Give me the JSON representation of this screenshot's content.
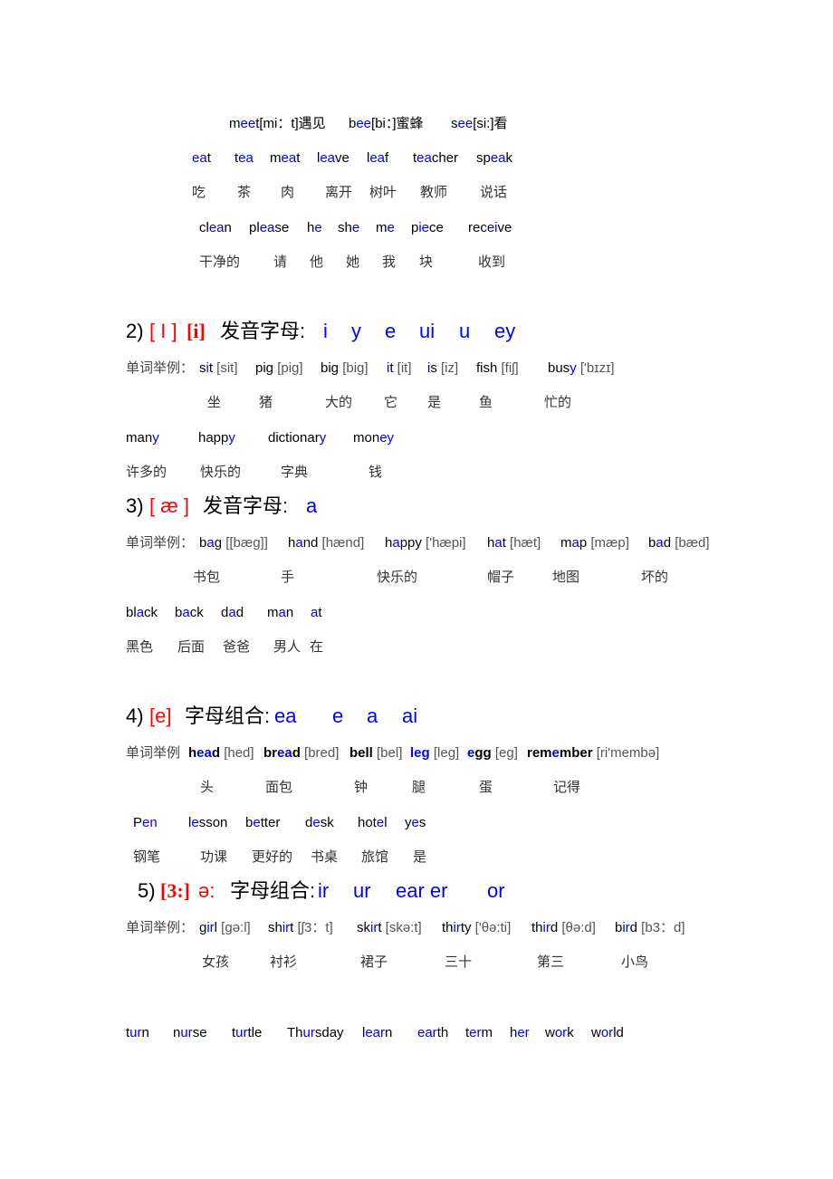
{
  "colors": {
    "highlight": "#0000ff",
    "phonetic_symbol": "#ff0000",
    "text": "#000000",
    "ipa": "#555555"
  },
  "section1": {
    "examples": [
      {
        "pre": "m",
        "hl": "ee",
        "post": "t[mi：t]遇见"
      },
      {
        "pre": "b",
        "hl": "ee",
        "post": "[bi：]蜜蜂"
      },
      {
        "pre": "s",
        "hl": "ee",
        "post": "[si:]看"
      }
    ],
    "words1": [
      {
        "pre": "",
        "hl": "ea",
        "post": "t"
      },
      {
        "pre": "t",
        "hl": "ea",
        "post": ""
      },
      {
        "pre": "m",
        "hl": "ea",
        "post": "t"
      },
      {
        "pre": "l",
        "hl": "ea",
        "post": "ve"
      },
      {
        "pre": "l",
        "hl": "ea",
        "post": "f"
      },
      {
        "pre": "t",
        "hl": "ea",
        "post": "cher"
      },
      {
        "pre": "sp",
        "hl": "ea",
        "post": "k"
      }
    ],
    "meanings1": [
      "吃",
      "茶",
      "肉",
      "离开",
      "树叶",
      "教师",
      "说话"
    ],
    "words2": [
      {
        "pre": "cl",
        "hl": "ea",
        "post": "n"
      },
      {
        "pre": "pl",
        "hl": "ea",
        "post": "se"
      },
      {
        "pre": "h",
        "hl": "e",
        "post": ""
      },
      {
        "pre": "sh",
        "hl": "e",
        "post": ""
      },
      {
        "pre": "m",
        "hl": "e",
        "post": ""
      },
      {
        "pre": "p",
        "hl": "ie",
        "post": "ce"
      },
      {
        "pre": "rec",
        "hl": "ei",
        "post": "ve"
      }
    ],
    "meanings2": [
      "干净的",
      "请",
      "他",
      "她",
      "我",
      "块",
      "收到"
    ]
  },
  "section2": {
    "heading": [
      {
        "t": "2)",
        "c": "black"
      },
      {
        "t": "[ Ι ]",
        "c": "red"
      },
      {
        "t": "[i]",
        "c": "red serif"
      },
      {
        "t": "发音字母:",
        "c": "black"
      },
      {
        "t": "i",
        "c": "blue"
      },
      {
        "t": "y",
        "c": "blue"
      },
      {
        "t": "e",
        "c": "blue"
      },
      {
        "t": "ui",
        "c": "blue"
      },
      {
        "t": "u",
        "c": "blue"
      },
      {
        "t": "ey",
        "c": "blue"
      }
    ],
    "label": "单词举例：",
    "examples": [
      {
        "pre": "s",
        "hl": "i",
        "post": "t",
        "ipa": " [sit]"
      },
      {
        "pre": "pig",
        "hl": "",
        "post": "",
        "ipa": " [piɡ]"
      },
      {
        "pre": "big",
        "hl": "",
        "post": "",
        "ipa": " [biɡ]"
      },
      {
        "pre": "",
        "hl": "i",
        "post": "t",
        "ipa": " [it]"
      },
      {
        "pre": "",
        "hl": "i",
        "post": "s",
        "ipa": " [iz]"
      },
      {
        "pre": "fish",
        "hl": "",
        "post": "",
        "ipa": " [fiʃ]"
      },
      {
        "pre": "bus",
        "hl": "y",
        "post": "",
        "ipa": " ['bɪzɪ]"
      }
    ],
    "meanings": [
      "坐",
      "猪",
      "大的",
      "它",
      "是",
      "鱼",
      "忙的"
    ],
    "words": [
      {
        "pre": "man",
        "hl": "y",
        "post": ""
      },
      {
        "pre": "happ",
        "hl": "y",
        "post": ""
      },
      {
        "pre": "dictionar",
        "hl": "y",
        "post": ""
      },
      {
        "pre": "mon",
        "hl": "ey",
        "post": ""
      }
    ],
    "meanings2": [
      "许多的",
      "快乐的",
      "字典",
      "钱"
    ]
  },
  "section3": {
    "heading": [
      {
        "t": "3)",
        "c": "black"
      },
      {
        "t": "[ æ ]",
        "c": "red"
      },
      {
        "t": "发音字母:",
        "c": "black"
      },
      {
        "t": "a",
        "c": "blue"
      }
    ],
    "label": "单词举例：",
    "examples": [
      {
        "pre": "b",
        "hl": "a",
        "post": "g",
        "ipa": " [[bæɡ]]"
      },
      {
        "pre": "h",
        "hl": "a",
        "post": "nd",
        "ipa": " [hænd]"
      },
      {
        "pre": "h",
        "hl": "a",
        "post": "ppy",
        "ipa": " ['hæpi]"
      },
      {
        "pre": "h",
        "hl": "a",
        "post": "t",
        "ipa": " [hæt]"
      },
      {
        "pre": "m",
        "hl": "a",
        "post": "p",
        "ipa": " [mæp]"
      },
      {
        "pre": "b",
        "hl": "a",
        "post": "d",
        "ipa": " [bæd]"
      }
    ],
    "meanings": [
      "书包",
      "手",
      "快乐的",
      "帽子",
      "地图",
      "坏的"
    ],
    "words": [
      {
        "pre": "bl",
        "hl": "a",
        "post": "ck"
      },
      {
        "pre": "b",
        "hl": "a",
        "post": "ck"
      },
      {
        "pre": "d",
        "hl": "a",
        "post": "d"
      },
      {
        "pre": "m",
        "hl": "a",
        "post": "n"
      },
      {
        "pre": "",
        "hl": "a",
        "post": "t"
      }
    ],
    "meanings2": [
      "黑色",
      "后面",
      "爸爸",
      "男人",
      "在"
    ]
  },
  "section4": {
    "heading": [
      {
        "t": "4)",
        "c": "black"
      },
      {
        "t": "[e]",
        "c": "red"
      },
      {
        "t": "字母组合:",
        "c": "black"
      },
      {
        "t": "ea",
        "c": "blue"
      },
      {
        "t": "e",
        "c": "blue"
      },
      {
        "t": "a",
        "c": "blue"
      },
      {
        "t": "ai",
        "c": "blue"
      }
    ],
    "label": "单词举例",
    "examples": [
      {
        "pre": "h",
        "hl": "ea",
        "post": "d",
        "ipa": " [hed]"
      },
      {
        "pre": "br",
        "hl": "ea",
        "post": "d",
        "ipa": " [bred]"
      },
      {
        "pre": "bell",
        "hl": "",
        "post": "",
        "ipa": " [bel]"
      },
      {
        "pre": "",
        "hl": "leg",
        "post": "",
        "ipa": " [leg]"
      },
      {
        "pre": "",
        "hl": "e",
        "post": "gg",
        "ipa": " [eg]"
      },
      {
        "pre": "rem",
        "hl": "e",
        "post": "mber",
        "ipa": " [ri'membə]"
      }
    ],
    "meanings": [
      "头",
      "面包",
      "钟",
      "腿",
      "蛋",
      "记得"
    ],
    "words": [
      {
        "pre": "P",
        "hl": "en",
        "post": ""
      },
      {
        "pre": "l",
        "hl": "e",
        "post": "sson"
      },
      {
        "pre": "b",
        "hl": "e",
        "post": "tter"
      },
      {
        "pre": "d",
        "hl": "e",
        "post": "sk"
      },
      {
        "pre": "hot",
        "hl": "e",
        "post": "l"
      },
      {
        "pre": "y",
        "hl": "e",
        "post": "s"
      }
    ],
    "meanings2": [
      "钢笔",
      "功课",
      "更好的",
      "书桌",
      "旅馆",
      "是"
    ]
  },
  "section5": {
    "heading": [
      {
        "t": "5)",
        "c": "black"
      },
      {
        "t": "[3:]",
        "c": "red serif"
      },
      {
        "t": "ə:",
        "c": "red"
      },
      {
        "t": "字母组合:",
        "c": "black"
      },
      {
        "t": "ir",
        "c": "blue"
      },
      {
        "t": "ur",
        "c": "blue"
      },
      {
        "t": "ear er",
        "c": "blue"
      },
      {
        "t": "or",
        "c": "blue"
      }
    ],
    "label": "单词举例：",
    "examples": [
      {
        "pre": "g",
        "hl": "ir",
        "post": "l",
        "ipa": " [ɡə:l]"
      },
      {
        "pre": "sh",
        "hl": "ir",
        "post": "t",
        "ipa": " [ʃ3：t]"
      },
      {
        "pre": "sk",
        "hl": "ir",
        "post": "t",
        "ipa": " [skə:t]"
      },
      {
        "pre": "th",
        "hl": "ir",
        "post": "ty",
        "ipa": " ['θə:ti]"
      },
      {
        "pre": "th",
        "hl": "ir",
        "post": "d",
        "ipa": " [θə:d]"
      },
      {
        "pre": "b",
        "hl": "ir",
        "post": "d",
        "ipa": " [b3：d]"
      }
    ],
    "meanings": [
      "女孩",
      "衬衫",
      "裙子",
      "三十",
      "第三",
      "小鸟"
    ],
    "words": [
      {
        "pre": "t",
        "hl": "ur",
        "post": "n"
      },
      {
        "pre": "n",
        "hl": "ur",
        "post": "se"
      },
      {
        "pre": "t",
        "hl": "ur",
        "post": "tle"
      },
      {
        "pre": "Th",
        "hl": "ur",
        "post": "sday"
      },
      {
        "pre": "l",
        "hl": "ear",
        "post": "n"
      },
      {
        "pre": "",
        "hl": "ear",
        "post": "th"
      },
      {
        "pre": "t",
        "hl": "er",
        "post": "m"
      },
      {
        "pre": "h",
        "hl": "er",
        "post": ""
      },
      {
        "pre": "w",
        "hl": "or",
        "post": "k"
      },
      {
        "pre": "w",
        "hl": "or",
        "post": "ld"
      }
    ]
  }
}
